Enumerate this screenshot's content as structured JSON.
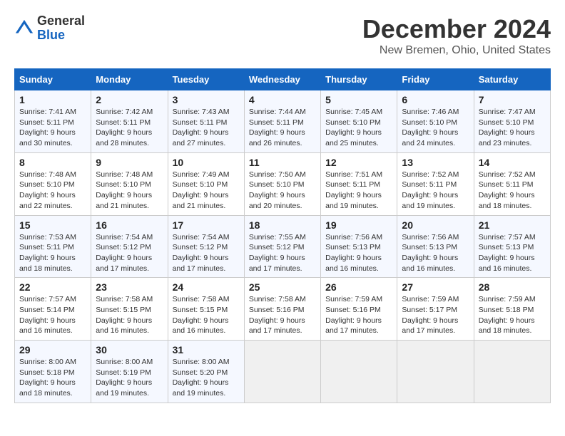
{
  "logo": {
    "general": "General",
    "blue": "Blue"
  },
  "title": "December 2024",
  "location": "New Bremen, Ohio, United States",
  "days_of_week": [
    "Sunday",
    "Monday",
    "Tuesday",
    "Wednesday",
    "Thursday",
    "Friday",
    "Saturday"
  ],
  "weeks": [
    [
      {
        "day": "1",
        "sunrise": "Sunrise: 7:41 AM",
        "sunset": "Sunset: 5:11 PM",
        "daylight": "Daylight: 9 hours and 30 minutes."
      },
      {
        "day": "2",
        "sunrise": "Sunrise: 7:42 AM",
        "sunset": "Sunset: 5:11 PM",
        "daylight": "Daylight: 9 hours and 28 minutes."
      },
      {
        "day": "3",
        "sunrise": "Sunrise: 7:43 AM",
        "sunset": "Sunset: 5:11 PM",
        "daylight": "Daylight: 9 hours and 27 minutes."
      },
      {
        "day": "4",
        "sunrise": "Sunrise: 7:44 AM",
        "sunset": "Sunset: 5:11 PM",
        "daylight": "Daylight: 9 hours and 26 minutes."
      },
      {
        "day": "5",
        "sunrise": "Sunrise: 7:45 AM",
        "sunset": "Sunset: 5:10 PM",
        "daylight": "Daylight: 9 hours and 25 minutes."
      },
      {
        "day": "6",
        "sunrise": "Sunrise: 7:46 AM",
        "sunset": "Sunset: 5:10 PM",
        "daylight": "Daylight: 9 hours and 24 minutes."
      },
      {
        "day": "7",
        "sunrise": "Sunrise: 7:47 AM",
        "sunset": "Sunset: 5:10 PM",
        "daylight": "Daylight: 9 hours and 23 minutes."
      }
    ],
    [
      {
        "day": "8",
        "sunrise": "Sunrise: 7:48 AM",
        "sunset": "Sunset: 5:10 PM",
        "daylight": "Daylight: 9 hours and 22 minutes."
      },
      {
        "day": "9",
        "sunrise": "Sunrise: 7:48 AM",
        "sunset": "Sunset: 5:10 PM",
        "daylight": "Daylight: 9 hours and 21 minutes."
      },
      {
        "day": "10",
        "sunrise": "Sunrise: 7:49 AM",
        "sunset": "Sunset: 5:10 PM",
        "daylight": "Daylight: 9 hours and 21 minutes."
      },
      {
        "day": "11",
        "sunrise": "Sunrise: 7:50 AM",
        "sunset": "Sunset: 5:10 PM",
        "daylight": "Daylight: 9 hours and 20 minutes."
      },
      {
        "day": "12",
        "sunrise": "Sunrise: 7:51 AM",
        "sunset": "Sunset: 5:11 PM",
        "daylight": "Daylight: 9 hours and 19 minutes."
      },
      {
        "day": "13",
        "sunrise": "Sunrise: 7:52 AM",
        "sunset": "Sunset: 5:11 PM",
        "daylight": "Daylight: 9 hours and 19 minutes."
      },
      {
        "day": "14",
        "sunrise": "Sunrise: 7:52 AM",
        "sunset": "Sunset: 5:11 PM",
        "daylight": "Daylight: 9 hours and 18 minutes."
      }
    ],
    [
      {
        "day": "15",
        "sunrise": "Sunrise: 7:53 AM",
        "sunset": "Sunset: 5:11 PM",
        "daylight": "Daylight: 9 hours and 18 minutes."
      },
      {
        "day": "16",
        "sunrise": "Sunrise: 7:54 AM",
        "sunset": "Sunset: 5:12 PM",
        "daylight": "Daylight: 9 hours and 17 minutes."
      },
      {
        "day": "17",
        "sunrise": "Sunrise: 7:54 AM",
        "sunset": "Sunset: 5:12 PM",
        "daylight": "Daylight: 9 hours and 17 minutes."
      },
      {
        "day": "18",
        "sunrise": "Sunrise: 7:55 AM",
        "sunset": "Sunset: 5:12 PM",
        "daylight": "Daylight: 9 hours and 17 minutes."
      },
      {
        "day": "19",
        "sunrise": "Sunrise: 7:56 AM",
        "sunset": "Sunset: 5:13 PM",
        "daylight": "Daylight: 9 hours and 16 minutes."
      },
      {
        "day": "20",
        "sunrise": "Sunrise: 7:56 AM",
        "sunset": "Sunset: 5:13 PM",
        "daylight": "Daylight: 9 hours and 16 minutes."
      },
      {
        "day": "21",
        "sunrise": "Sunrise: 7:57 AM",
        "sunset": "Sunset: 5:13 PM",
        "daylight": "Daylight: 9 hours and 16 minutes."
      }
    ],
    [
      {
        "day": "22",
        "sunrise": "Sunrise: 7:57 AM",
        "sunset": "Sunset: 5:14 PM",
        "daylight": "Daylight: 9 hours and 16 minutes."
      },
      {
        "day": "23",
        "sunrise": "Sunrise: 7:58 AM",
        "sunset": "Sunset: 5:15 PM",
        "daylight": "Daylight: 9 hours and 16 minutes."
      },
      {
        "day": "24",
        "sunrise": "Sunrise: 7:58 AM",
        "sunset": "Sunset: 5:15 PM",
        "daylight": "Daylight: 9 hours and 16 minutes."
      },
      {
        "day": "25",
        "sunrise": "Sunrise: 7:58 AM",
        "sunset": "Sunset: 5:16 PM",
        "daylight": "Daylight: 9 hours and 17 minutes."
      },
      {
        "day": "26",
        "sunrise": "Sunrise: 7:59 AM",
        "sunset": "Sunset: 5:16 PM",
        "daylight": "Daylight: 9 hours and 17 minutes."
      },
      {
        "day": "27",
        "sunrise": "Sunrise: 7:59 AM",
        "sunset": "Sunset: 5:17 PM",
        "daylight": "Daylight: 9 hours and 17 minutes."
      },
      {
        "day": "28",
        "sunrise": "Sunrise: 7:59 AM",
        "sunset": "Sunset: 5:18 PM",
        "daylight": "Daylight: 9 hours and 18 minutes."
      }
    ],
    [
      {
        "day": "29",
        "sunrise": "Sunrise: 8:00 AM",
        "sunset": "Sunset: 5:18 PM",
        "daylight": "Daylight: 9 hours and 18 minutes."
      },
      {
        "day": "30",
        "sunrise": "Sunrise: 8:00 AM",
        "sunset": "Sunset: 5:19 PM",
        "daylight": "Daylight: 9 hours and 19 minutes."
      },
      {
        "day": "31",
        "sunrise": "Sunrise: 8:00 AM",
        "sunset": "Sunset: 5:20 PM",
        "daylight": "Daylight: 9 hours and 19 minutes."
      },
      null,
      null,
      null,
      null
    ]
  ]
}
